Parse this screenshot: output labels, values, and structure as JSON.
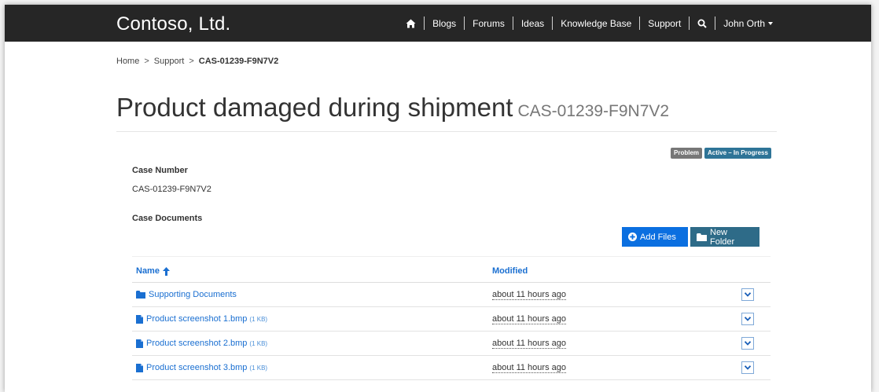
{
  "brand": "Contoso, Ltd.",
  "nav": {
    "blogs": "Blogs",
    "forums": "Forums",
    "ideas": "Ideas",
    "knowledge_base": "Knowledge Base",
    "support": "Support",
    "user": "John Orth",
    "home_icon": "home-icon",
    "search_icon": "search-icon"
  },
  "breadcrumb": {
    "home": "Home",
    "support": "Support",
    "current": "CAS-01239-F9N7V2",
    "separator": ">"
  },
  "title": "Product damaged during shipment",
  "title_case": "CAS-01239-F9N7V2",
  "badges": {
    "type": "Problem",
    "status": "Active – In Progress"
  },
  "case_number": {
    "label": "Case Number",
    "value": "CAS-01239-F9N7V2"
  },
  "documents": {
    "label": "Case Documents",
    "add_files": "Add Files",
    "new_folder": "New Folder",
    "columns": {
      "name": "Name",
      "modified": "Modified"
    },
    "rows": [
      {
        "name": "Supporting Documents",
        "size": "",
        "modified": "about 11 hours ago",
        "type": "folder"
      },
      {
        "name": "Product screenshot 1.bmp",
        "size": "(1 KB)",
        "modified": "about 11 hours ago",
        "type": "file"
      },
      {
        "name": "Product screenshot 2.bmp",
        "size": "(1 KB)",
        "modified": "about 11 hours ago",
        "type": "file"
      },
      {
        "name": "Product screenshot 3.bmp",
        "size": "(1 KB)",
        "modified": "about 11 hours ago",
        "type": "file"
      }
    ]
  },
  "colors": {
    "navbar": "#262626",
    "link": "#1a6fd1",
    "add_button": "#0b6fe0",
    "folder_button": "#2e6b88",
    "status_badge": "#2e7497",
    "problem_badge": "#777777"
  }
}
